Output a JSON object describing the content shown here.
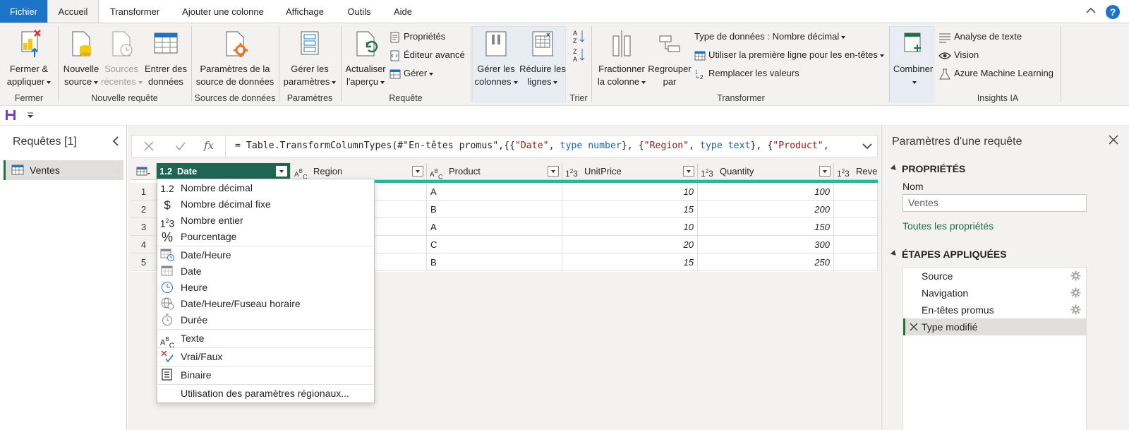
{
  "tabs": [
    {
      "label": "Fichier"
    },
    {
      "label": "Accueil"
    },
    {
      "label": "Transformer"
    },
    {
      "label": "Ajouter une colonne"
    },
    {
      "label": "Affichage"
    },
    {
      "label": "Outils"
    },
    {
      "label": "Aide"
    }
  ],
  "ribbon": {
    "fermer": {
      "button1": "Fermer &",
      "button2": "appliquer",
      "group": "Fermer"
    },
    "nouvelle": {
      "source1": "Nouvelle",
      "source2": "source",
      "recentes1": "Sources",
      "recentes2": "récentes",
      "entrer1": "Entrer des",
      "entrer2": "données",
      "group": "Nouvelle requête"
    },
    "sources": {
      "btn1": "Paramètres de la",
      "btn2": "source de données",
      "group": "Sources de données"
    },
    "params": {
      "btn1": "Gérer les",
      "btn2": "paramètres",
      "group": "Paramètres"
    },
    "requete": {
      "act1": "Actualiser",
      "act2": "l'aperçu",
      "proprietes": "Propriétés",
      "editeur": "Éditeur avancé",
      "gerer": "Gérer",
      "group": "Requête"
    },
    "colonnes": {
      "btn1": "Gérer les",
      "btn2": "colonnes"
    },
    "lignes": {
      "btn1": "Réduire les",
      "btn2": "lignes"
    },
    "trier": {
      "group": "Trier"
    },
    "transformer": {
      "frac1": "Fractionner",
      "frac2": "la colonne",
      "reg1": "Regrouper",
      "reg2": "par",
      "type_donnees": "Type de données : Nombre décimal",
      "premiere_ligne": "Utiliser la première ligne pour les en-têtes",
      "remplacer": "Remplacer les valeurs",
      "group": "Transformer"
    },
    "combiner": {
      "btn1": "Combiner"
    },
    "insights": {
      "texte": "Analyse de texte",
      "vision": "Vision",
      "azure": "Azure Machine Learning",
      "group": "Insights IA"
    }
  },
  "left": {
    "title": "Requêtes [1]",
    "queries": [
      "Ventes"
    ]
  },
  "formula": {
    "fx": "fx",
    "p1": "= Table.TransformColumnTypes(#\"En-têtes promus\",{{",
    "s1": "\"Date\"",
    "p2": ", ",
    "k1": "type number",
    "p3": "}, {",
    "s2": "\"Region\"",
    "p4": ", ",
    "k2": "type text",
    "p5": "}, {",
    "s3": "\"Product\"",
    "p6": ","
  },
  "grid": {
    "columns": [
      {
        "type": "1.2",
        "name": "Date"
      },
      {
        "type": "ABC",
        "name": "Region"
      },
      {
        "type": "ABC",
        "name": "Product"
      },
      {
        "type": "123",
        "name": "UnitPrice"
      },
      {
        "type": "123",
        "name": "Quantity"
      },
      {
        "type": "123",
        "name": "Reven"
      }
    ],
    "rows": [
      {
        "n": "1",
        "product": "A",
        "unitprice": "10",
        "quantity": "100"
      },
      {
        "n": "2",
        "product": "B",
        "unitprice": "15",
        "quantity": "200"
      },
      {
        "n": "3",
        "product": "A",
        "unitprice": "10",
        "quantity": "150"
      },
      {
        "n": "4",
        "product": "C",
        "unitprice": "20",
        "quantity": "300"
      },
      {
        "n": "5",
        "product": "B",
        "unitprice": "15",
        "quantity": "250"
      }
    ]
  },
  "type_menu": {
    "items": [
      {
        "icon": "1.2",
        "label": "Nombre décimal"
      },
      {
        "icon": "$",
        "label": "Nombre décimal fixe"
      },
      {
        "icon": "123",
        "label": "Nombre entier"
      },
      {
        "icon": "%",
        "label": "Pourcentage"
      },
      {
        "icon": "datetime",
        "label": "Date/Heure"
      },
      {
        "icon": "date",
        "label": "Date"
      },
      {
        "icon": "time",
        "label": "Heure"
      },
      {
        "icon": "timezone",
        "label": "Date/Heure/Fuseau horaire"
      },
      {
        "icon": "duration",
        "label": "Durée"
      },
      {
        "icon": "ABC",
        "label": "Texte"
      },
      {
        "icon": "truefalse",
        "label": "Vrai/Faux"
      },
      {
        "icon": "binary",
        "label": "Binaire"
      },
      {
        "icon": "",
        "label": "Utilisation des paramètres régionaux..."
      }
    ]
  },
  "right": {
    "title": "Paramètres d'une requête",
    "props_title": "PROPRIÉTÉS",
    "name_label": "Nom",
    "name_value": "Ventes",
    "all_props": "Toutes les propriétés",
    "steps_title": "ÉTAPES APPLIQUÉES",
    "steps": [
      {
        "label": "Source"
      },
      {
        "label": "Navigation"
      },
      {
        "label": "En-têtes promus"
      },
      {
        "label": "Type modifié"
      }
    ]
  },
  "colors": {
    "accent": "#217346",
    "file_tab": "#1c74c9",
    "selected_header": "#1e6650",
    "quality_bar": "#2bb5a0"
  }
}
